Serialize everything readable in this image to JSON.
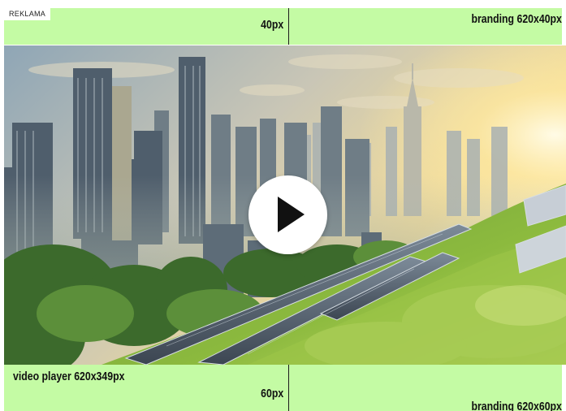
{
  "ad": {
    "label": "REKLAMA"
  },
  "top_banner": {
    "left_label": "40px",
    "right_label": "branding 620x40px"
  },
  "video_player": {
    "label": "video player 620x349px",
    "play_icon": "play-icon"
  },
  "bottom_banner": {
    "left_label": "60px",
    "right_label": "branding 620x60px"
  },
  "colors": {
    "banner_green": "#c4fba4",
    "divider": "#1a1a1a",
    "play_button_bg": "#ffffff",
    "play_icon": "#111111"
  }
}
